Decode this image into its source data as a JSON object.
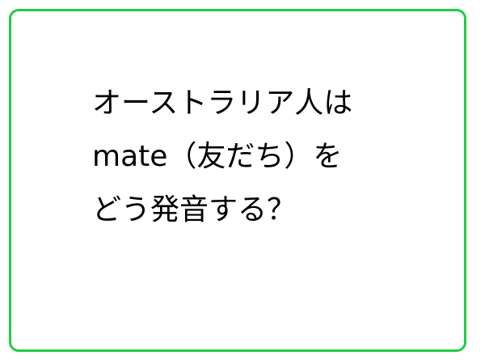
{
  "card": {
    "border_color": "#22cc44",
    "lines": [
      "オーストラリア人は",
      "mate（友だち）を",
      "どう発音する？"
    ]
  }
}
